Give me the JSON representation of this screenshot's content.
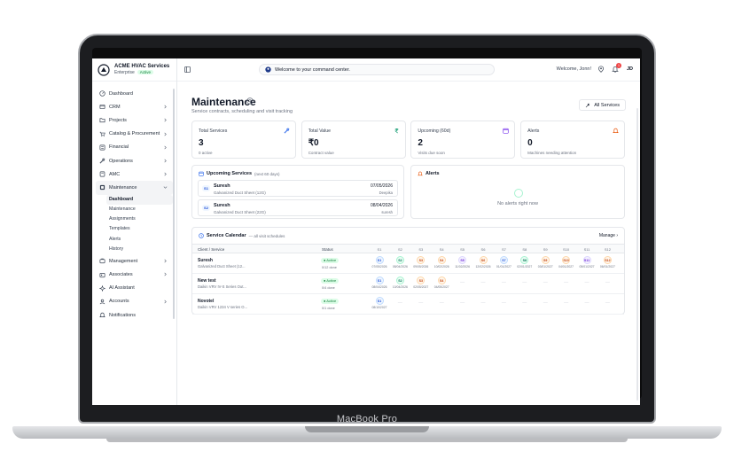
{
  "device": {
    "label": "MacBook Pro"
  },
  "org": {
    "name": "ACME HVAC Services",
    "plan": "Enterprise",
    "status": "Active"
  },
  "sidebar": {
    "items": [
      {
        "label": "Dashboard",
        "icon": "dashboard-icon",
        "chevron": false
      },
      {
        "label": "CRM",
        "icon": "crm-icon",
        "chevron": true
      },
      {
        "label": "Projects",
        "icon": "projects-icon",
        "chevron": true
      },
      {
        "label": "Catalog & Procurement",
        "icon": "cart-icon",
        "chevron": true
      },
      {
        "label": "Financial",
        "icon": "financial-icon",
        "chevron": true
      },
      {
        "label": "Operations",
        "icon": "wrench-icon",
        "chevron": true
      },
      {
        "label": "AMC",
        "icon": "amc-icon",
        "chevron": true
      },
      {
        "label": "Maintenance",
        "icon": "maintenance-icon",
        "chevron": true,
        "active": true
      }
    ],
    "sub_items": [
      {
        "label": "Dashboard",
        "active": true
      },
      {
        "label": "Maintenance"
      },
      {
        "label": "Assignments"
      },
      {
        "label": "Templates"
      },
      {
        "label": "Alerts"
      },
      {
        "label": "History"
      }
    ],
    "items_after": [
      {
        "label": "Management",
        "icon": "management-icon",
        "chevron": true
      },
      {
        "label": "Associates",
        "icon": "associates-icon",
        "chevron": true
      },
      {
        "label": "AI Assistant",
        "icon": "ai-icon",
        "chevron": false
      },
      {
        "label": "Accounts",
        "icon": "accounts-icon",
        "chevron": true
      },
      {
        "label": "Notifications",
        "icon": "bell-icon",
        "chevron": false
      }
    ]
  },
  "topbar": {
    "command_text": "Welcome to your command center.",
    "welcome": "Welcome, Jonn!",
    "notification_count": "1",
    "user_initials": "JD"
  },
  "page": {
    "title": "Maintenance",
    "subtitle": "Service contracts, scheduling and visit tracking",
    "all_services_label": "All Services"
  },
  "stats": [
    {
      "label": "Total Services",
      "value": "3",
      "hint": "0 active",
      "icon": "wrench-icon",
      "color": "#2563eb"
    },
    {
      "label": "Total Value",
      "value": "₹0",
      "hint": "Contract value",
      "icon": "rupee-icon",
      "color": "#059669"
    },
    {
      "label": "Upcoming (60d)",
      "value": "2",
      "hint": "Visits due soon",
      "icon": "calendar-icon",
      "color": "#7c3aed"
    },
    {
      "label": "Alerts",
      "value": "0",
      "hint": "Machines needing attention",
      "icon": "bell-icon",
      "color": "#ea580c"
    }
  ],
  "upcoming": {
    "title": "Upcoming Services",
    "note": "(next 60 days)",
    "rows": [
      {
        "pill": "S1",
        "name": "Suresh",
        "model": "Galvanized Duct Sheet (12G)",
        "date": "07/05/2026",
        "tech": "Deepika"
      },
      {
        "pill": "S2",
        "name": "Suresh",
        "model": "Galvanized Duct Sheet (22G)",
        "date": "08/04/2026",
        "tech": "suresh"
      }
    ]
  },
  "alerts": {
    "title": "Alerts",
    "empty": "No alerts right now"
  },
  "calendar": {
    "title": "Service Calendar",
    "note": "— all visit schedules",
    "manage": "Manage",
    "col_client": "Client / Service",
    "col_status": "Status",
    "slots": [
      "S1",
      "S2",
      "S3",
      "S4",
      "S5",
      "S6",
      "S7",
      "S8",
      "S9",
      "S10",
      "S11",
      "S12"
    ],
    "rows": [
      {
        "name": "Suresh",
        "model": "Galvanized Duct Sheet (12...",
        "status": "● Active",
        "done": "0/12 done",
        "visits": [
          {
            "label": "S1",
            "date": "07/05/2026",
            "tone": "blue"
          },
          {
            "label": "S2",
            "date": "08/04/2026",
            "tone": "green"
          },
          {
            "label": "S3",
            "date": "09/05/2026",
            "tone": "orange"
          },
          {
            "label": "S4",
            "date": "10/02/2026",
            "tone": "orange"
          },
          {
            "label": "S5",
            "date": "11/02/2026",
            "tone": "purple"
          },
          {
            "label": "S6",
            "date": "12/02/2026",
            "tone": "orange"
          },
          {
            "label": "S7",
            "date": "01/01/2027",
            "tone": "blue"
          },
          {
            "label": "S8",
            "date": "02/01/2027",
            "tone": "green"
          },
          {
            "label": "S9",
            "date": "03/01/2027",
            "tone": "orange"
          },
          {
            "label": "S10",
            "date": "04/01/2027",
            "tone": "orange"
          },
          {
            "label": "S11",
            "date": "05/01/2027",
            "tone": "purple"
          },
          {
            "label": "S12",
            "date": "06/01/2027",
            "tone": "orange"
          }
        ]
      },
      {
        "name": "New test",
        "model": "Daikin VRV IV-S Series Out...",
        "status": "● Active",
        "done": "0/4 done",
        "visits": [
          {
            "label": "S1",
            "date": "08/04/2026",
            "tone": "blue"
          },
          {
            "label": "S2",
            "date": "10/04/2026",
            "tone": "green"
          },
          {
            "label": "S3",
            "date": "02/05/2027",
            "tone": "orange"
          },
          {
            "label": "S4",
            "date": "04/05/2027",
            "tone": "orange"
          }
        ]
      },
      {
        "name": "Novotel",
        "model": "Daikin VRV 1234 V series O...",
        "status": "● Active",
        "done": "0/1 done",
        "visits": [
          {
            "label": "S1",
            "date": "08/10/2027",
            "tone": "blue"
          }
        ]
      }
    ],
    "dash": "—"
  }
}
